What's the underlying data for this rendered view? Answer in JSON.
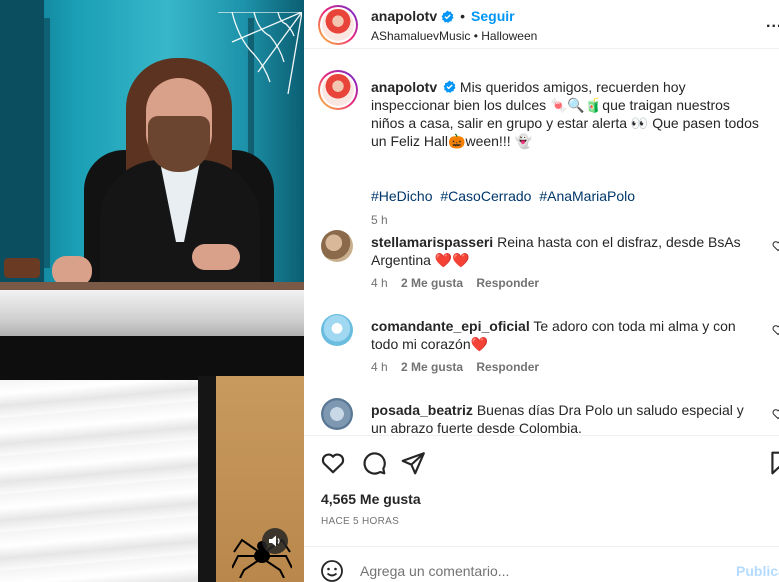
{
  "post": {
    "username": "anapolotv",
    "follow_label": "Seguir",
    "dot": "•",
    "music": "AShamaluevMusic",
    "location": "Halloween",
    "more": "..."
  },
  "caption": {
    "username": "anapolotv",
    "text_part1": "Mis queridos amigos, recuerden hoy inspeccionar bien los dulces 🍬🔍🧃que traigan nuestros niños a casa, salir en grupo y estar alerta 👀 Que pasen todos un Feliz Hall🎃ween!!! 👻",
    "hashtags": [
      "#HeDicho",
      "#CasoCerrado",
      "#AnaMariaPolo"
    ],
    "time": "5 h"
  },
  "comments": [
    {
      "username": "stellamarispasseri",
      "text": "Reina hasta con el disfraz, desde BsAs Argentina ❤️❤️",
      "time": "4 h",
      "likes": "2 Me gusta",
      "reply": "Responder"
    },
    {
      "username": "comandante_epi_oficial",
      "text": "Te adoro con toda mi alma y con todo mi corazón❤️",
      "time": "4 h",
      "likes": "2 Me gusta",
      "reply": "Responder"
    },
    {
      "username": "posada_beatriz",
      "text": "Buenas días Dra Polo un saludo especial y un abrazo fuerte desde Colombia.",
      "time": "",
      "likes": "",
      "reply": ""
    }
  ],
  "stats": {
    "likes": "4,565 Me gusta",
    "ago": "HACE 5 HORAS"
  },
  "add_comment": {
    "placeholder": "Agrega un comentario...",
    "publish": "Publicar"
  },
  "icons": {
    "verified": "verified-badge-icon",
    "like": "heart-icon",
    "comment": "comment-icon",
    "share": "paper-plane-icon",
    "save": "bookmark-icon",
    "emoji": "smiley-icon",
    "audio": "speaker-icon",
    "decor_web": "spiderweb-icon",
    "decor_spider": "spider-icon"
  },
  "colors": {
    "link_blue": "#0095f6",
    "hashtag": "#00376b",
    "muted": "#737373",
    "publish_disabled": "#b3dbff"
  }
}
